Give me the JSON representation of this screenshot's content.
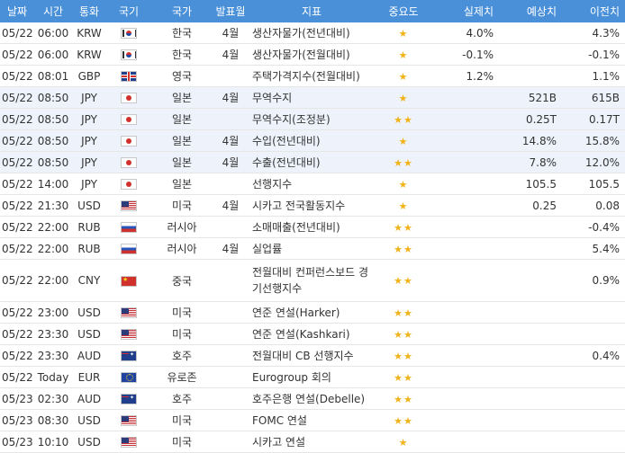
{
  "header": {
    "date": "날짜",
    "time": "시간",
    "currency": "통화",
    "flag": "국기",
    "country": "국가",
    "period": "발표월",
    "indicator": "지표",
    "importance": "중요도",
    "actual": "실제치",
    "forecast": "예상치",
    "previous": "이전치"
  },
  "rows": [
    {
      "date": "05/22",
      "time": "06:00",
      "currency": "KRW",
      "flag": "kr",
      "country": "한국",
      "period": "4월",
      "indicator": "생산자물가(전년대비)",
      "stars": "★",
      "actual": "4.0%",
      "forecast": "",
      "previous": "4.3%"
    },
    {
      "date": "05/22",
      "time": "06:00",
      "currency": "KRW",
      "flag": "kr",
      "country": "한국",
      "period": "4월",
      "indicator": "생산자물가(전월대비)",
      "stars": "★",
      "actual": "-0.1%",
      "forecast": "",
      "previous": "-0.1%"
    },
    {
      "date": "05/22",
      "time": "08:01",
      "currency": "GBP",
      "flag": "gb",
      "country": "영국",
      "period": "",
      "indicator": "주택가격지수(전월대비)",
      "stars": "★",
      "actual": "1.2%",
      "forecast": "",
      "previous": "1.1%"
    },
    {
      "date": "05/22",
      "time": "08:50",
      "currency": "JPY",
      "flag": "jp",
      "country": "일본",
      "period": "4월",
      "indicator": "무역수지",
      "stars": "★",
      "actual": "",
      "forecast": "521B",
      "previous": "615B"
    },
    {
      "date": "05/22",
      "time": "08:50",
      "currency": "JPY",
      "flag": "jp",
      "country": "일본",
      "period": "",
      "indicator": "무역수지(조정분)",
      "stars": "★★",
      "actual": "",
      "forecast": "0.25T",
      "previous": "0.17T"
    },
    {
      "date": "05/22",
      "time": "08:50",
      "currency": "JPY",
      "flag": "jp",
      "country": "일본",
      "period": "4월",
      "indicator": "수입(전년대비)",
      "stars": "★",
      "actual": "",
      "forecast": "14.8%",
      "previous": "15.8%"
    },
    {
      "date": "05/22",
      "time": "08:50",
      "currency": "JPY",
      "flag": "jp",
      "country": "일본",
      "period": "4월",
      "indicator": "수출(전년대비)",
      "stars": "★★",
      "actual": "",
      "forecast": "7.8%",
      "previous": "12.0%"
    },
    {
      "date": "05/22",
      "time": "14:00",
      "currency": "JPY",
      "flag": "jp",
      "country": "일본",
      "period": "",
      "indicator": "선행지수",
      "stars": "★",
      "actual": "",
      "forecast": "105.5",
      "previous": "105.5"
    },
    {
      "date": "05/22",
      "time": "21:30",
      "currency": "USD",
      "flag": "us",
      "country": "미국",
      "period": "4월",
      "indicator": "시카고 전국활동지수",
      "stars": "★",
      "actual": "",
      "forecast": "0.25",
      "previous": "0.08"
    },
    {
      "date": "05/22",
      "time": "22:00",
      "currency": "RUB",
      "flag": "ru",
      "country": "러시아",
      "period": "",
      "indicator": "소매매출(전년대비)",
      "stars": "★★",
      "actual": "",
      "forecast": "",
      "previous": "-0.4%"
    },
    {
      "date": "05/22",
      "time": "22:00",
      "currency": "RUB",
      "flag": "ru",
      "country": "러시아",
      "period": "4월",
      "indicator": "실업률",
      "stars": "★★",
      "actual": "",
      "forecast": "",
      "previous": "5.4%"
    },
    {
      "date": "05/22",
      "time": "22:00",
      "currency": "CNY",
      "flag": "cn",
      "country": "중국",
      "period": "",
      "indicator": "전월대비 컨퍼런스보드 경기선행지수",
      "stars": "★★",
      "actual": "",
      "forecast": "",
      "previous": "0.9%"
    },
    {
      "date": "05/22",
      "time": "23:00",
      "currency": "USD",
      "flag": "us",
      "country": "미국",
      "period": "",
      "indicator": "연준 연설(Harker)",
      "stars": "★★",
      "actual": "",
      "forecast": "",
      "previous": ""
    },
    {
      "date": "05/22",
      "time": "23:30",
      "currency": "USD",
      "flag": "us",
      "country": "미국",
      "period": "",
      "indicator": "연준 연설(Kashkari)",
      "stars": "★★",
      "actual": "",
      "forecast": "",
      "previous": ""
    },
    {
      "date": "05/22",
      "time": "23:30",
      "currency": "AUD",
      "flag": "au",
      "country": "호주",
      "period": "",
      "indicator": "전월대비 CB 선행지수",
      "stars": "★★",
      "actual": "",
      "forecast": "",
      "previous": "0.4%"
    },
    {
      "date": "05/22",
      "time": "Today",
      "currency": "EUR",
      "flag": "eu",
      "country": "유로존",
      "period": "",
      "indicator": "Eurogroup 회의",
      "stars": "★★",
      "actual": "",
      "forecast": "",
      "previous": ""
    },
    {
      "date": "05/23",
      "time": "02:30",
      "currency": "AUD",
      "flag": "au",
      "country": "호주",
      "period": "",
      "indicator": "호주은행 연설(Debelle)",
      "stars": "★★",
      "actual": "",
      "forecast": "",
      "previous": ""
    },
    {
      "date": "05/23",
      "time": "08:30",
      "currency": "USD",
      "flag": "us",
      "country": "미국",
      "period": "",
      "indicator": "FOMC 연설",
      "stars": "★★",
      "actual": "",
      "forecast": "",
      "previous": ""
    },
    {
      "date": "05/23",
      "time": "10:10",
      "currency": "USD",
      "flag": "us",
      "country": "미국",
      "period": "",
      "indicator": "시카고 연설",
      "stars": "★",
      "actual": "",
      "forecast": "",
      "previous": ""
    }
  ]
}
